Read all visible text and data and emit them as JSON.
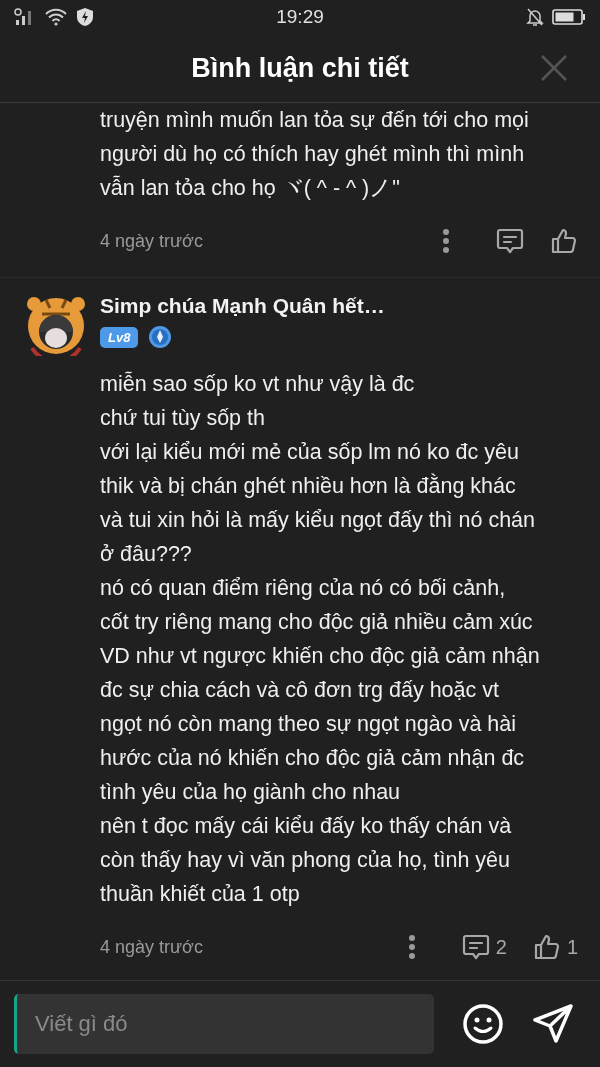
{
  "status_bar": {
    "time": "19:29"
  },
  "header": {
    "title": "Bình luận chi tiết"
  },
  "comments": [
    {
      "kind": "partial",
      "lines": [
        "truyện mình muốn lan tỏa sự đến tới cho mọi",
        "người dù họ có thích hay ghét mình thì mình",
        "vẫn lan tỏa cho họ ヾ( ^ - ^ )ノ\""
      ],
      "time": "4 ngày trước"
    },
    {
      "kind": "full",
      "author": "Simp chúa Mạnh Quân hết…",
      "level": "Lv8",
      "lines": [
        "miễn sao sốp ko vt như vậy là đc",
        "chứ tui tùy sốp th",
        "với lại kiểu mới mẻ của sốp lm nó ko đc yêu",
        "thik và bị chán ghét nhiều hơn là đằng khác",
        "và tui xin hỏi là mấy kiểu ngọt đấy thì nó chán",
        "ở đâu???",
        "nó có quan điểm riêng của nó có bối cảnh,",
        "cốt try riêng mang cho độc giả nhiều cảm xúc",
        "VD như vt ngược khiến cho độc giả cảm nhận",
        "đc sự chia cách và cô đơn trg đấy hoặc vt",
        "ngọt nó còn mang theo sự ngọt ngào và hài",
        "hước của nó khiến cho độc giả cảm nhận đc",
        "tình yêu của họ giành cho nhau",
        "nên t đọc mấy cái kiểu đấy ko thấy chán và",
        "còn thấy hay vì văn phong của họ, tình yêu",
        "thuần khiết của 1 otp"
      ],
      "time": "4 ngày trước",
      "replies": "2",
      "likes": "1"
    }
  ],
  "composer": {
    "placeholder": "Viết gì đó"
  }
}
